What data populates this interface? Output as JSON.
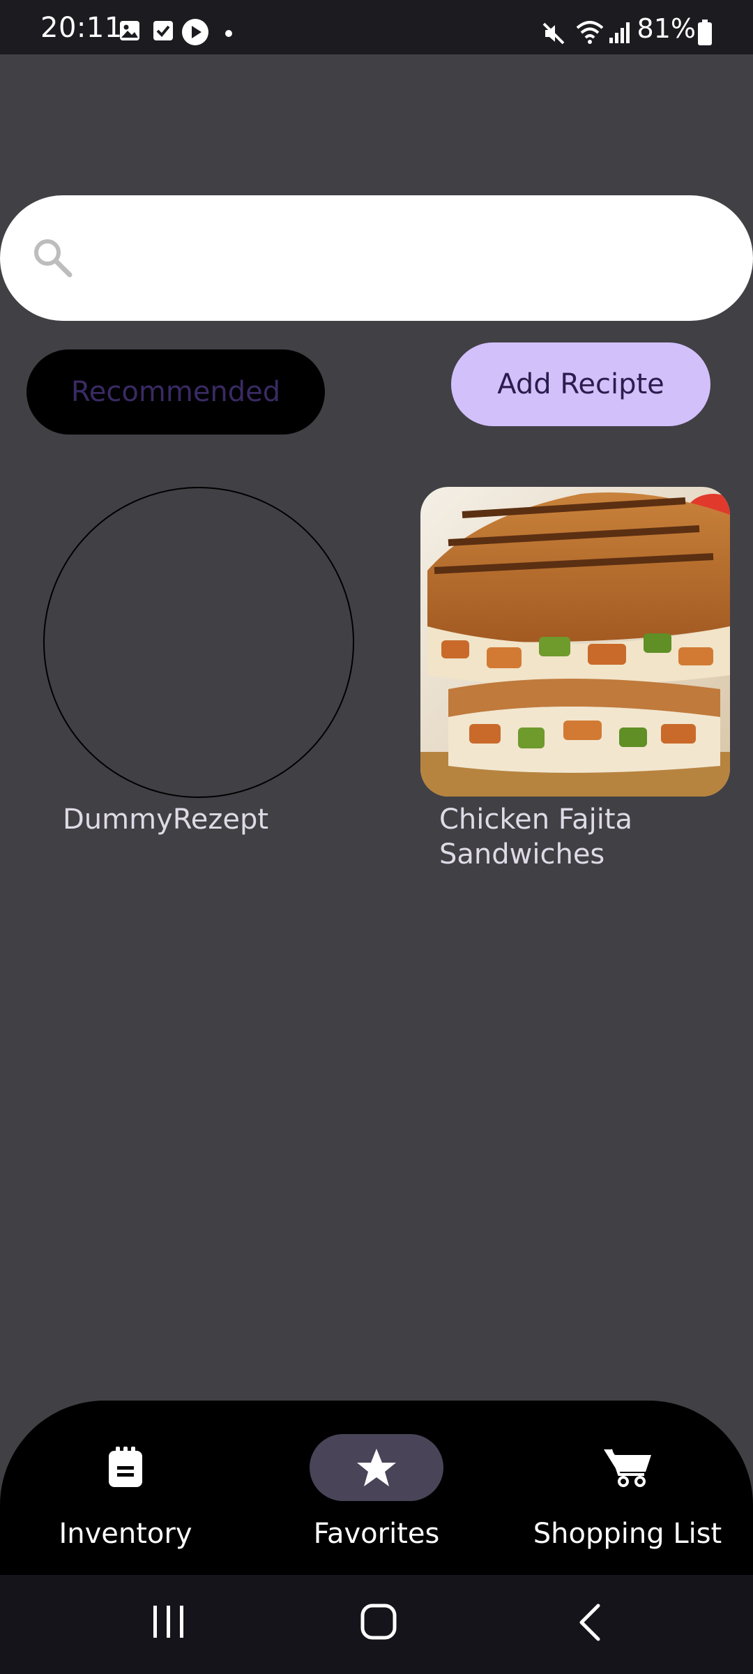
{
  "status_bar": {
    "time": "20:11",
    "battery": "81%",
    "icons": [
      "image-icon",
      "check-box-icon",
      "play-icon",
      "dot-icon",
      "mute-icon",
      "wifi-icon",
      "signal-icon",
      "battery-icon"
    ]
  },
  "search": {
    "value": "",
    "placeholder": "",
    "icon": "search-icon"
  },
  "buttons": {
    "recommended": "Recommended",
    "add_recipe": "Add Recipte"
  },
  "recipes": [
    {
      "name": "DummyRezept",
      "has_image": false
    },
    {
      "name": "Chicken Fajita Sandwiches",
      "has_image": true
    }
  ],
  "bottom_nav": {
    "items": [
      {
        "label": "Inventory",
        "icon": "clipboard-icon",
        "active": false
      },
      {
        "label": "Favorites",
        "icon": "star-icon",
        "active": true
      },
      {
        "label": "Shopping List",
        "icon": "cart-icon",
        "active": false
      }
    ]
  },
  "system_nav": {
    "icons": [
      "recent-apps-icon",
      "home-icon",
      "back-icon"
    ]
  },
  "colors": {
    "background": "#414045",
    "search_bg": "#ffffff",
    "recommended_bg": "#000000",
    "recommended_text": "#3a2a63",
    "add_button_bg": "#d2c0fb",
    "nav_bg": "#000000",
    "nav_active_pill": "#4a4458"
  }
}
